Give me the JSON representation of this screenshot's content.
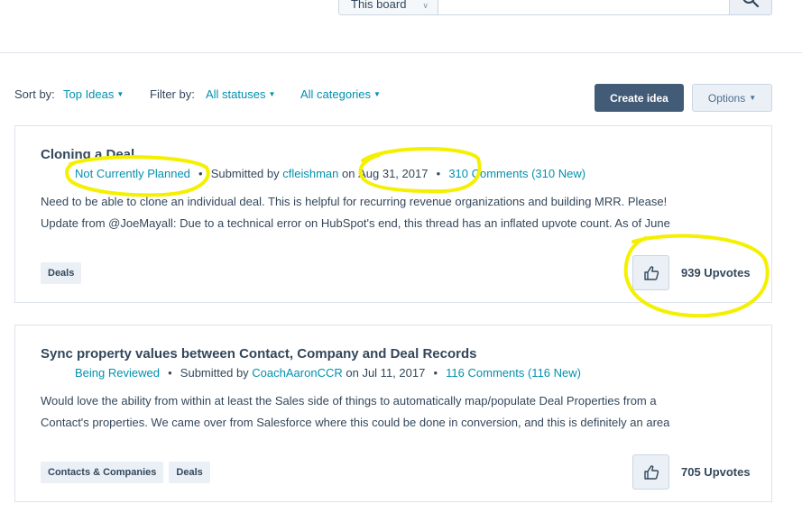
{
  "search": {
    "scope_label": "This board",
    "query": ""
  },
  "controls": {
    "sort_label": "Sort by:",
    "sort_value": "Top Ideas",
    "filter_label": "Filter by:",
    "status_value": "All statuses",
    "category_value": "All categories",
    "create_label": "Create idea",
    "options_label": "Options"
  },
  "ideas": [
    {
      "title": "Cloning a Deal",
      "status": "Not Currently Planned",
      "submitted_by_label": "Submitted by",
      "author": "cfleishman",
      "date_prefix": "on",
      "date": "Aug 31, 2017",
      "comments": "310 Comments (310 New)",
      "desc_lines": [
        "Need to be able to clone an individual deal. This is helpful for recurring revenue organizations and building MRR. Please!",
        "Update from @JoeMayall:  Due to a technical error on HubSpot's end, this thread has an inflated upvote count. As of June"
      ],
      "tags": [
        "Deals"
      ],
      "upvotes": "939 Upvotes"
    },
    {
      "title": "Sync property values between Contact, Company and Deal Records",
      "status": "Being Reviewed",
      "submitted_by_label": "Submitted by",
      "author": "CoachAaronCCR",
      "date_prefix": "on",
      "date": "Jul 11, 2017",
      "comments": "116 Comments (116 New)",
      "desc_lines": [
        "Would love the ability from within at least the Sales side of things to automatically map/populate Deal Properties from a",
        "Contact's properties. We came over from Salesforce where this could be done in conversion, and this is definitely an area"
      ],
      "tags": [
        "Contacts & Companies",
        "Deals"
      ],
      "upvotes": "705 Upvotes"
    }
  ],
  "colors": {
    "link": "#0091ae",
    "text": "#33475b",
    "primary_button": "#425b76",
    "highlight": "#f4f000"
  },
  "icons": {
    "search": "search-icon",
    "thumbs_up": "thumbs-up-icon",
    "caret": "caret-down-icon"
  }
}
